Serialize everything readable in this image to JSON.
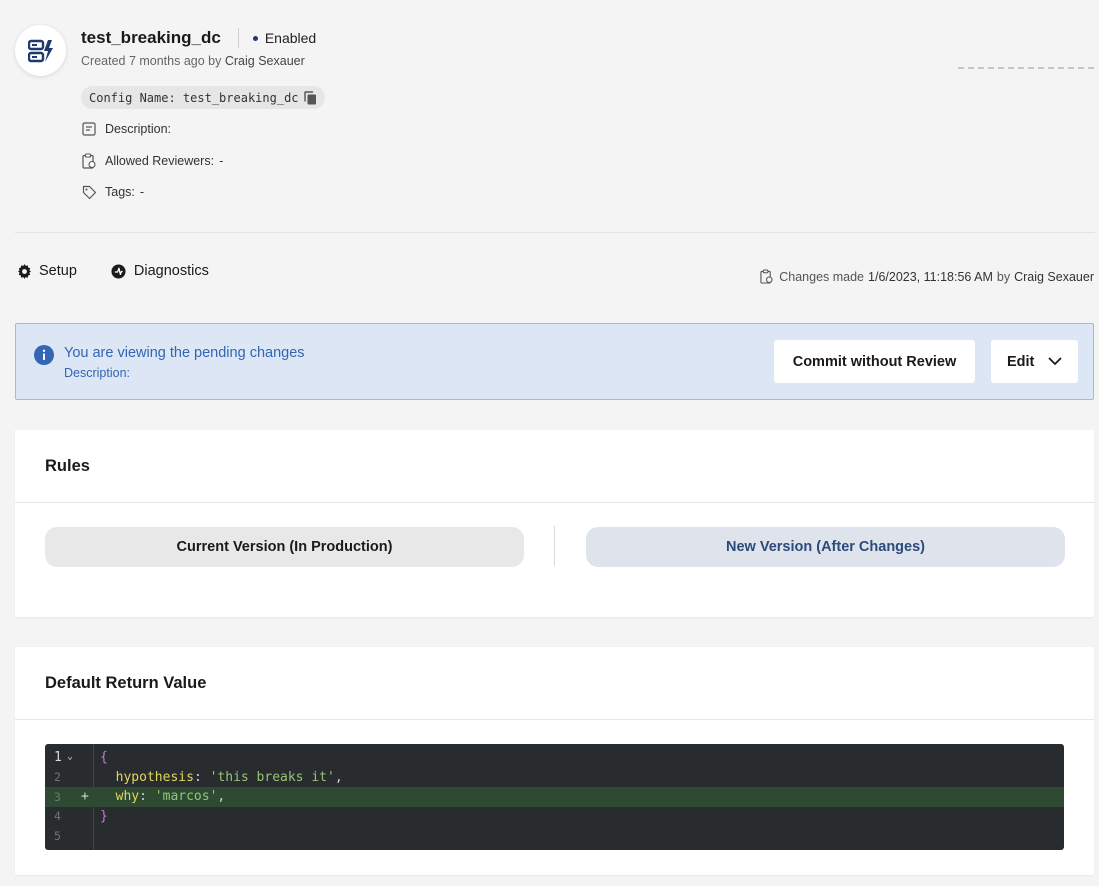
{
  "header": {
    "title": "test_breaking_dc",
    "status": "Enabled",
    "created_prefix": "Created 7 months ago by",
    "created_author": "Craig Sexauer",
    "config_name": "Config Name: test_breaking_dc",
    "description_label": "Description:",
    "reviewers_label": "Allowed Reviewers:",
    "reviewers_value": "-",
    "tags_label": "Tags:",
    "tags_value": "-"
  },
  "tabs": [
    {
      "label": "Setup",
      "icon": "gear-icon"
    },
    {
      "label": "Diagnostics",
      "icon": "diagnostics-icon"
    }
  ],
  "changes": {
    "prefix": "Changes made",
    "timestamp": "1/6/2023, 11:18:56 AM",
    "by": "by",
    "author": "Craig Sexauer"
  },
  "banner": {
    "title": "You are viewing the pending changes",
    "description": "Description:",
    "commit_label": "Commit without Review",
    "edit_label": "Edit"
  },
  "rules": {
    "title": "Rules",
    "current_label": "Current Version (In Production)",
    "new_label": "New Version (After Changes)"
  },
  "default_return": {
    "title": "Default Return Value",
    "line_numbers": [
      "1",
      "2",
      "3",
      "4",
      "5"
    ],
    "code": {
      "open": "{",
      "key1": "hypothesis",
      "val1": "'this breaks it'",
      "key2": "why",
      "val2": "'marcos'",
      "close": "}",
      "added_marker": "+"
    }
  },
  "colors": {
    "accent": "#3366b3",
    "banner_bg": "#dce6f5",
    "status_dot": "#1f3b6e",
    "editor_bg": "#282c2f",
    "added_line": "#2e4a33"
  }
}
